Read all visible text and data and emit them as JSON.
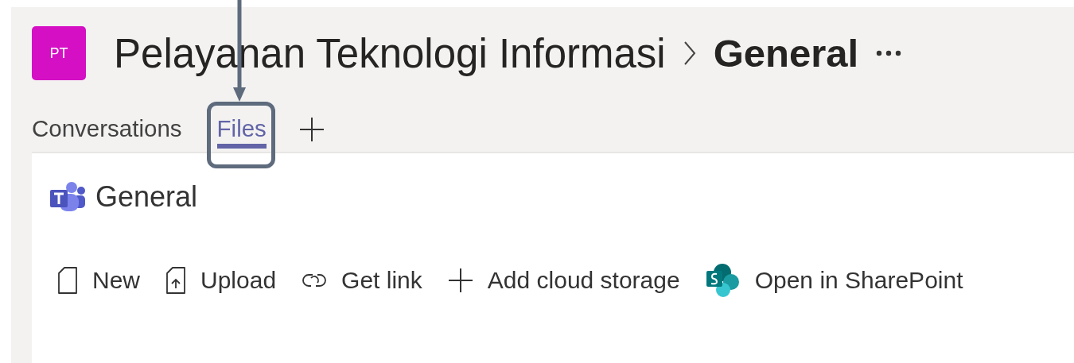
{
  "team": {
    "initials": "PT",
    "name": "Pelayanan Teknologi Informasi",
    "channel": "General"
  },
  "tabs": [
    {
      "label": "Conversations",
      "selected": false
    },
    {
      "label": "Files",
      "selected": true
    }
  ],
  "files": {
    "title": "General",
    "toolbar": [
      {
        "kind": "new",
        "label": "New"
      },
      {
        "kind": "upload",
        "label": "Upload"
      },
      {
        "kind": "link",
        "label": "Get link"
      },
      {
        "kind": "add",
        "label": "Add cloud storage"
      },
      {
        "kind": "sharepoint",
        "label": "Open in SharePoint"
      }
    ]
  }
}
